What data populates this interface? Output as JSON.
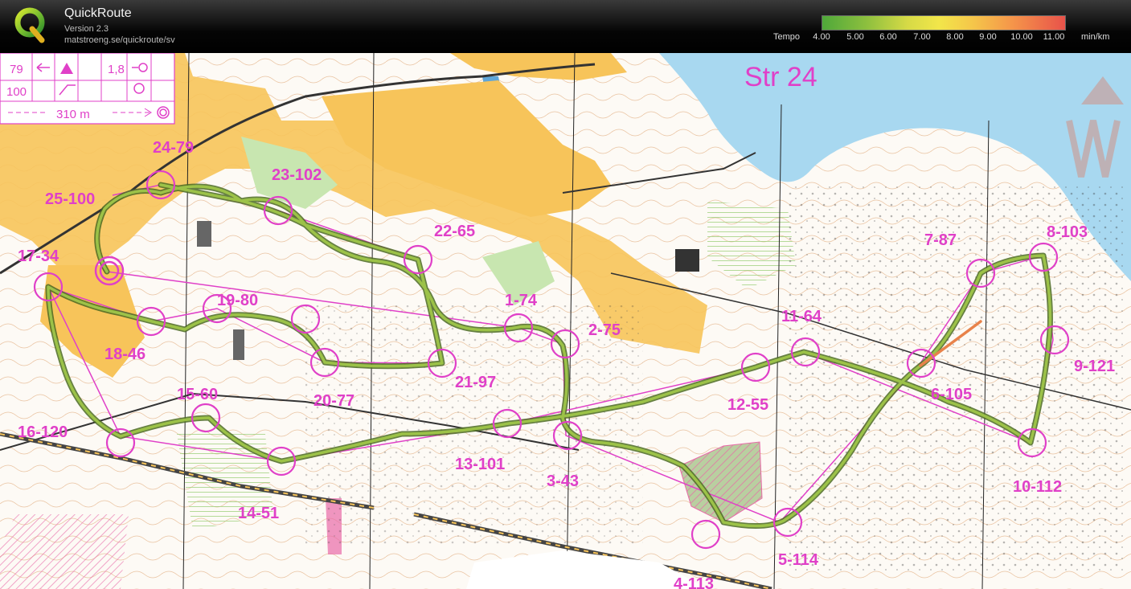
{
  "app": {
    "title": "QuickRoute",
    "version": "Version 2.3",
    "url": "matstroeng.se/quickroute/sv",
    "logo_icon": "quickroute-q-logo"
  },
  "tempo": {
    "label": "Tempo",
    "ticks": [
      "4.00",
      "5.00",
      "6.00",
      "7.00",
      "8.00",
      "9.00",
      "10.00",
      "11.00"
    ],
    "unit": "min/km",
    "colors": [
      "#4fa83a",
      "#a8c83e",
      "#f2e64a",
      "#f5a64a",
      "#e8524a"
    ]
  },
  "map": {
    "title": "Str 24",
    "legend": {
      "row1": {
        "num": "79",
        "val": "1,8"
      },
      "row2": {
        "num": "100"
      },
      "distance": "310 m"
    },
    "controls": [
      {
        "label": "1-74"
      },
      {
        "label": "2-75"
      },
      {
        "label": "3-43"
      },
      {
        "label": "4-113"
      },
      {
        "label": "5-114"
      },
      {
        "label": "6-105"
      },
      {
        "label": "7-87"
      },
      {
        "label": "8-103"
      },
      {
        "label": "9-121"
      },
      {
        "label": "10-112"
      },
      {
        "label": "11-64"
      },
      {
        "label": "12-55"
      },
      {
        "label": "13-101"
      },
      {
        "label": "14-51"
      },
      {
        "label": "15-60"
      },
      {
        "label": "16-120"
      },
      {
        "label": "17-34"
      },
      {
        "label": "18-46"
      },
      {
        "label": "19-80"
      },
      {
        "label": "20-77"
      },
      {
        "label": "21-97"
      },
      {
        "label": "22-65"
      },
      {
        "label": "23-102"
      },
      {
        "label": "24-79"
      },
      {
        "label": "25-100"
      }
    ]
  },
  "colors": {
    "course": "#e040c8",
    "water": "#a8d8f0",
    "open": "#f7c45a",
    "forest_green": "#c8e6b0",
    "contour": "#c87a3a"
  }
}
